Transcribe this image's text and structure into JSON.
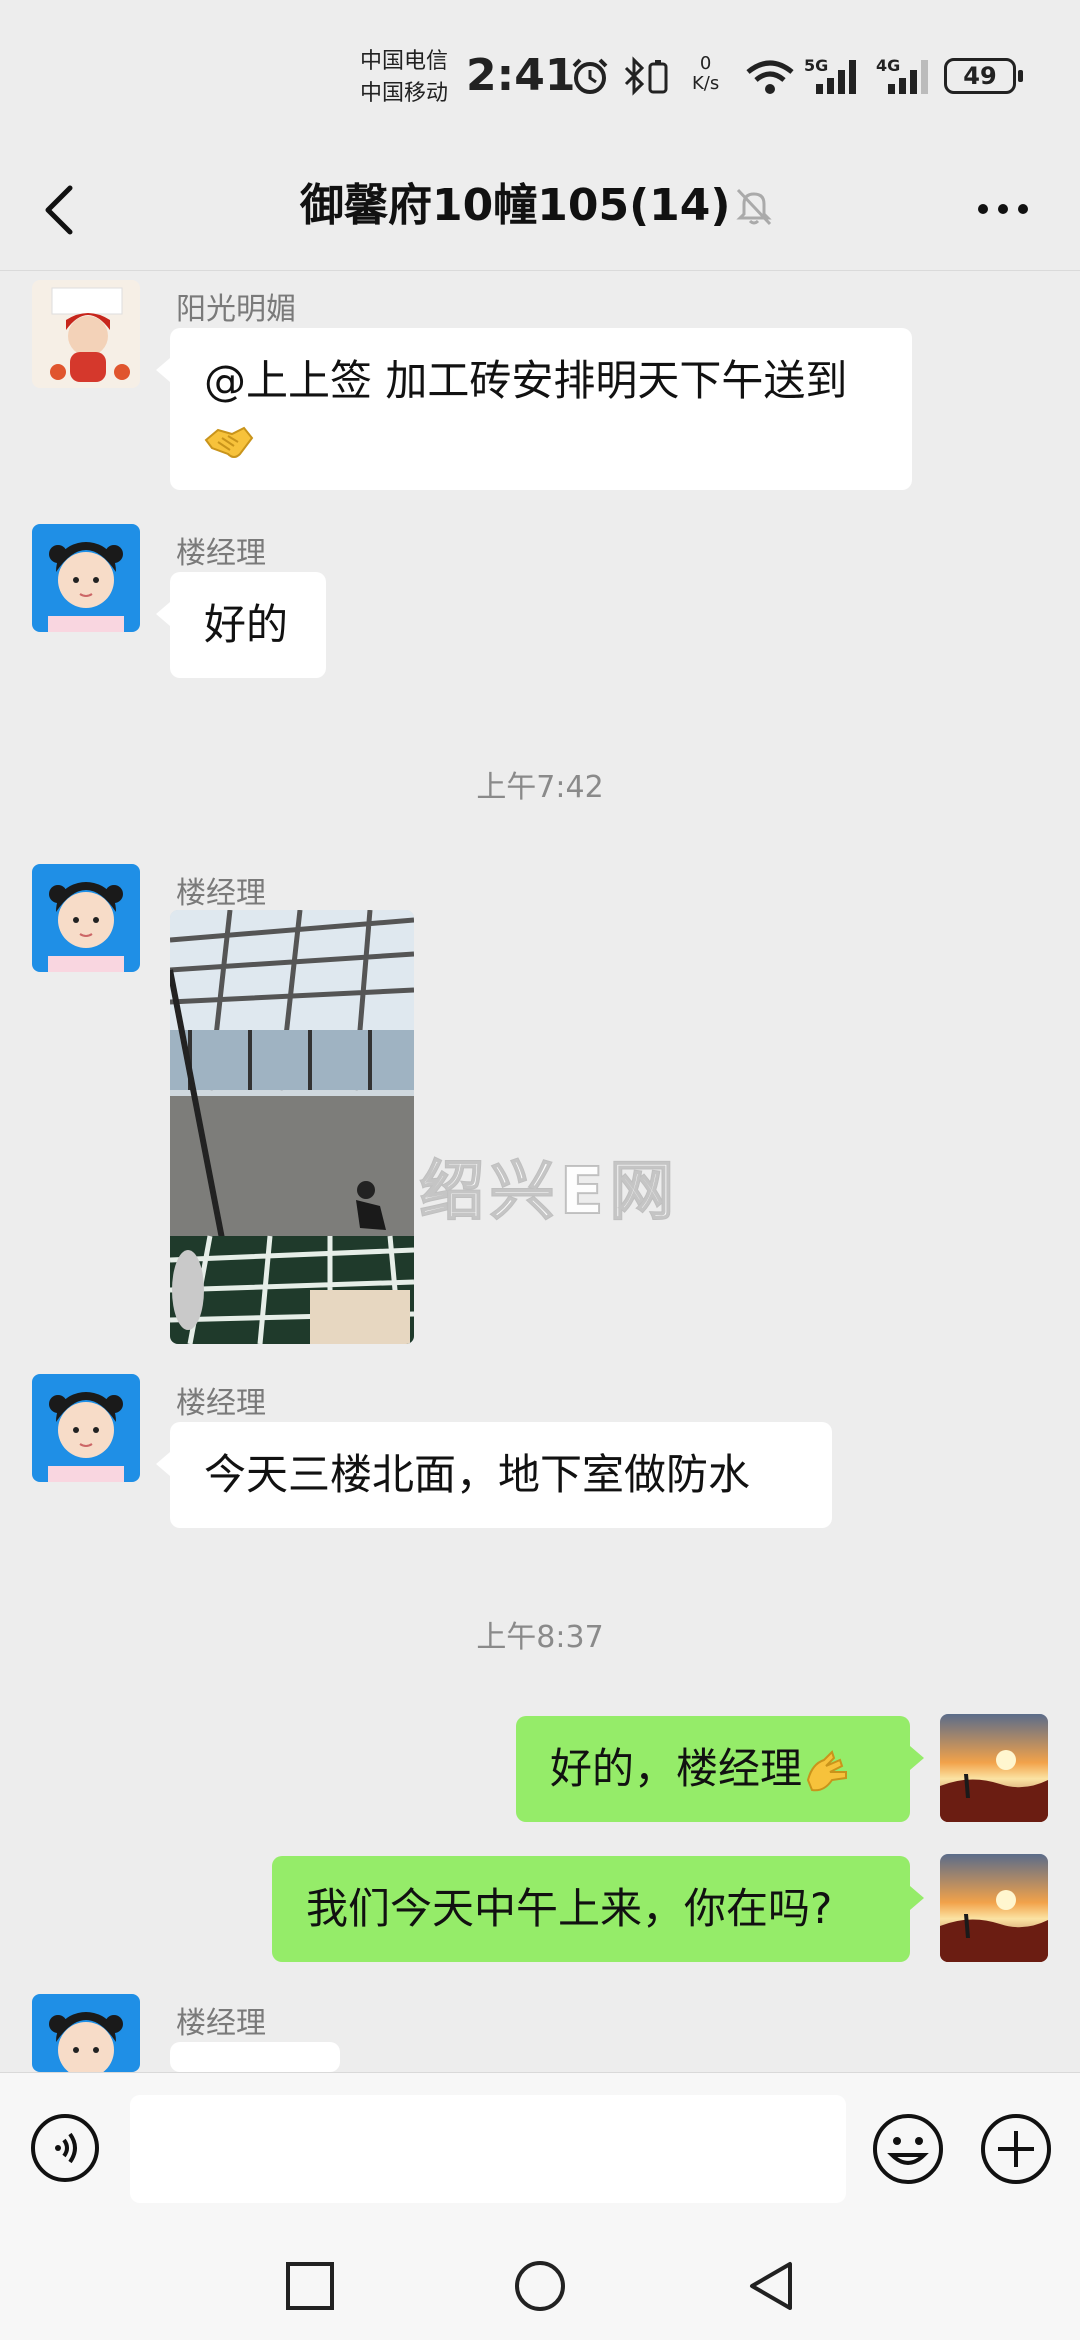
{
  "status": {
    "carrier_1": "中国电信",
    "carrier_2": "中国移动",
    "time": "2:41",
    "net_speed_value": "0",
    "net_speed_unit": "K/s",
    "signal_1": "5G",
    "signal_2": "4G",
    "battery": "49"
  },
  "header": {
    "title": "御馨府10幢105(14)",
    "muted": true
  },
  "messages": [
    {
      "sender": "阳光明媚",
      "text": "@上上签  加工砖安排明天下午送到",
      "emoji": "handshake"
    },
    {
      "sender": "楼经理",
      "text": "好的"
    },
    {
      "timestamp": "上午7:42"
    },
    {
      "sender": "楼经理",
      "type": "image"
    },
    {
      "sender": "楼经理",
      "text": "今天三楼北面，地下室做防水"
    },
    {
      "timestamp": "上午8:37"
    },
    {
      "sender": "me",
      "text": "好的，楼经理",
      "emoji": "ok-hand"
    },
    {
      "sender": "me",
      "text": "我们今天中午上来，你在吗?"
    },
    {
      "sender": "楼经理",
      "text": ""
    }
  ],
  "watermark": "绍兴E网",
  "colors": {
    "background": "#ededed",
    "my_bubble": "#95ec69",
    "their_bubble": "#ffffff",
    "sender_name": "#7a7a7a"
  },
  "icons": [
    "back-icon",
    "mute-icon",
    "more-icon",
    "voice-icon",
    "emoji-icon",
    "plus-icon",
    "recents-icon",
    "home-icon",
    "back-triangle-icon"
  ]
}
